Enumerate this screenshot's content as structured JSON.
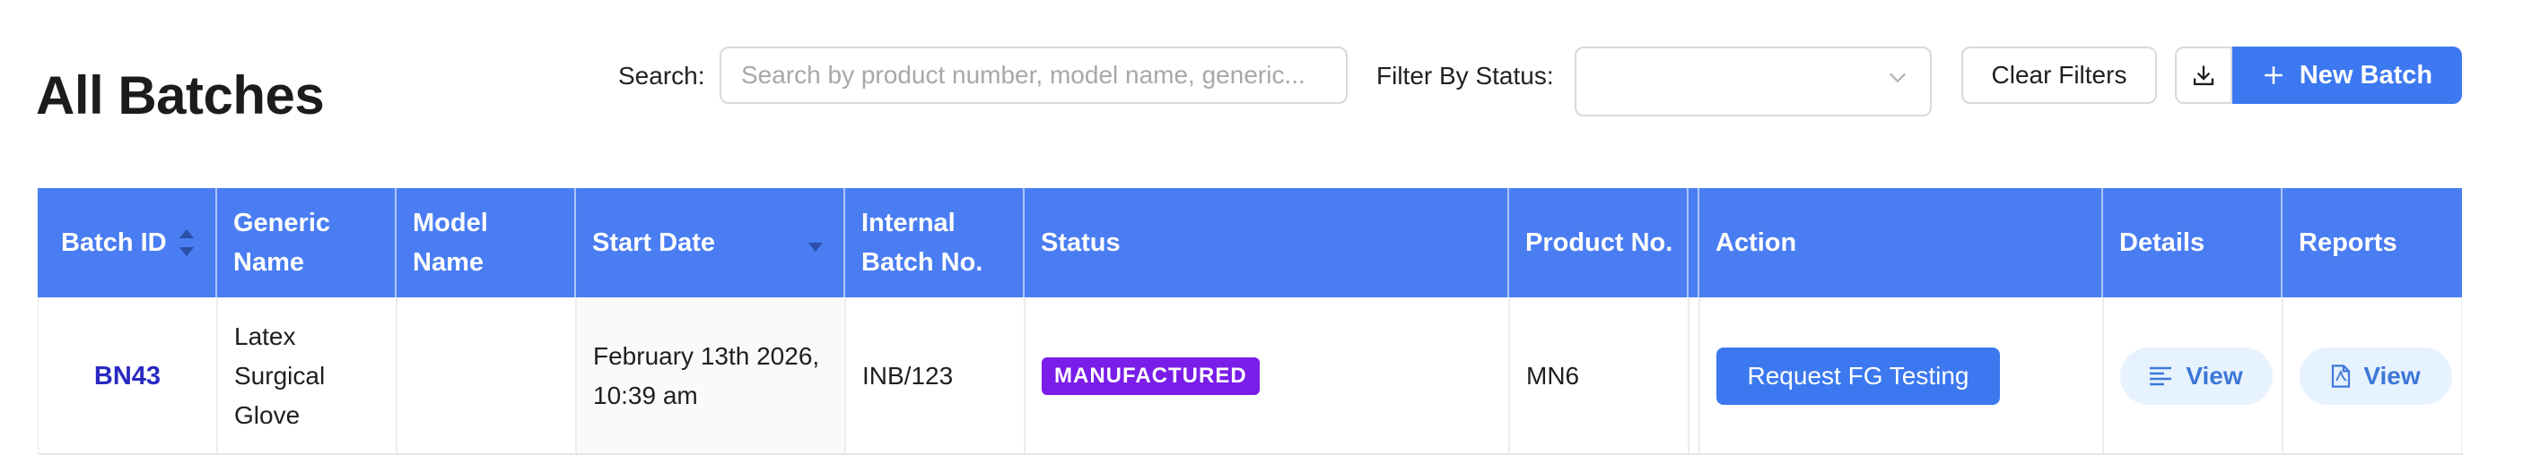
{
  "page": {
    "title": "All Batches"
  },
  "toolbar": {
    "search_label": "Search:",
    "search_placeholder": "Search by product number, model name, generic...",
    "search_value": "",
    "filter_label": "Filter By Status:",
    "filter_value": "",
    "clear_label": "Clear Filters",
    "new_batch_label": "New Batch"
  },
  "table": {
    "columns": [
      {
        "label": "Batch ID",
        "sort": "unsorted"
      },
      {
        "label": "Generic Name"
      },
      {
        "label": "Model Name"
      },
      {
        "label": "Start Date",
        "sort": "descending"
      },
      {
        "label": "Internal Batch No."
      },
      {
        "label": "Status"
      },
      {
        "label": "Product No."
      },
      {
        "label": "Action"
      },
      {
        "label": "Details"
      },
      {
        "label": "Reports"
      }
    ],
    "rows": [
      {
        "batch_id": "BN43",
        "generic_name": "Latex Surgical Glove",
        "model_name": "",
        "start_date": "February 13th 2026, 10:39 am",
        "internal_batch_no": "INB/123",
        "status": "MANUFACTURED",
        "product_no": "MN6",
        "action_label": "Request FG Testing",
        "details_label": "View",
        "reports_label": "View"
      }
    ]
  },
  "colors": {
    "header_bg": "#4a7df2",
    "primary_button": "#3c78f0",
    "status_manufactured": "#7a1de8",
    "batch_link": "#2929c2",
    "view_button_bg": "#e7f2ff"
  }
}
